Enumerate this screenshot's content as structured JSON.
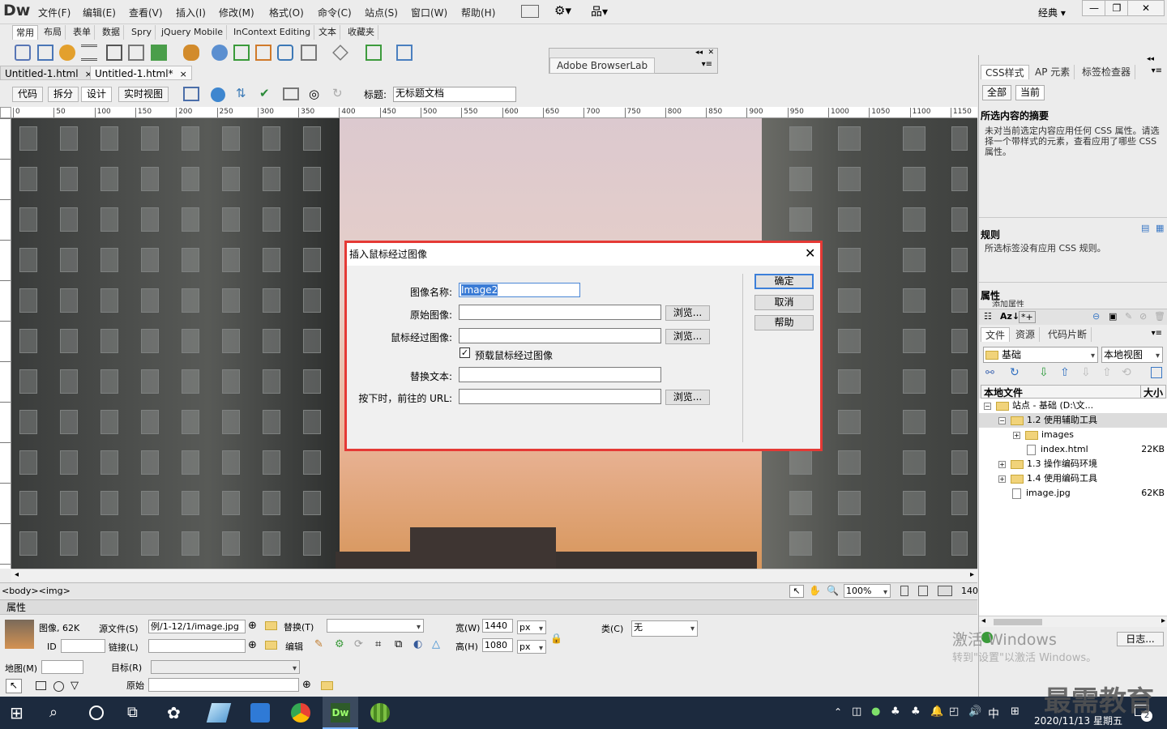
{
  "app": {
    "logo": "Dw",
    "menus": [
      "文件(F)",
      "编辑(E)",
      "查看(V)",
      "插入(I)",
      "修改(M)",
      "格式(O)",
      "命令(C)",
      "站点(S)",
      "窗口(W)",
      "帮助(H)"
    ],
    "workspace": "经典",
    "window_controls": [
      "—",
      "❐",
      "✕"
    ]
  },
  "insert_bar": {
    "tabs": [
      "常用",
      "布局",
      "表单",
      "数据",
      "Spry",
      "jQuery Mobile",
      "InContext Editing",
      "文本",
      "收藏夹"
    ]
  },
  "browserlab": {
    "title": "Adobe BrowserLab"
  },
  "documents": {
    "tabs": [
      {
        "label": "Untitled-1.html",
        "close": "×"
      },
      {
        "label": "Untitled-1.html*",
        "close": "×"
      }
    ]
  },
  "doc_toolbar": {
    "views": [
      "代码",
      "拆分",
      "设计",
      "实时视图"
    ],
    "title_label": "标题:",
    "title_value": "无标题文档"
  },
  "ruler": {
    "h_ticks": [
      "0",
      "50",
      "100",
      "150",
      "200",
      "250",
      "300",
      "350",
      "400",
      "450",
      "500",
      "550",
      "600",
      "650",
      "700",
      "750",
      "800",
      "850",
      "900",
      "950",
      "1000",
      "1050",
      "1100",
      "1150"
    ]
  },
  "status_bar": {
    "tag_selector": "<body><img>",
    "zoom": "100%",
    "width_text": "140"
  },
  "dialog": {
    "title": "插入鼠标经过图像",
    "fields": {
      "image_name_label": "图像名称:",
      "image_name_value": "Image2",
      "original_label": "原始图像:",
      "rollover_label": "鼠标经过图像:",
      "preload_label": "预载鼠标经过图像",
      "alt_label": "替换文本:",
      "url_label": "按下时，前往的 URL:"
    },
    "browse": "浏览...",
    "buttons": {
      "ok": "确定",
      "cancel": "取消",
      "help": "帮助"
    }
  },
  "properties": {
    "header": "属性",
    "image_label": "图像, 62K",
    "src_label": "源文件(S)",
    "src_value": "例/1-12/1/image.jpg",
    "alt_label": "替换(T)",
    "width_label": "宽(W)",
    "width_value": "1440",
    "height_label": "高(H)",
    "height_value": "1080",
    "unit": "px",
    "class_label": "类(C)",
    "class_value": "无",
    "id_label": "ID",
    "link_label": "链接(L)",
    "edit_label": "编辑",
    "map_label": "地图(M)",
    "target_label": "目标(R)",
    "original_label": "原始"
  },
  "right_panel": {
    "css_tabs": [
      "CSS样式",
      "AP 元素",
      "标签检查器"
    ],
    "mode_buttons": [
      "全部",
      "当前"
    ],
    "summary_heading": "所选内容的摘要",
    "summary_text": "未对当前选定内容应用任何 CSS 属性。请选择一个带样式的元素，查看应用了哪些 CSS 属性。",
    "rules_heading": "规则",
    "rules_text": "所选标签没有应用 CSS 规则。",
    "props_heading": "属性",
    "props_sub": "添加属性",
    "files_tabs": [
      "文件",
      "资源",
      "代码片断"
    ],
    "site_select": "基础",
    "view_select": "本地视图",
    "local_files_header": "本地文件",
    "size_header": "大小",
    "tree": [
      {
        "label": "站点 - 基础 (D:\\文...",
        "size": "",
        "level": 0,
        "folder": true,
        "toggle": "−"
      },
      {
        "label": "1.2 使用辅助工具",
        "size": "",
        "level": 1,
        "folder": true,
        "toggle": "−",
        "selected": true
      },
      {
        "label": "images",
        "size": "",
        "level": 2,
        "folder": true,
        "toggle": "+"
      },
      {
        "label": "index.html",
        "size": "22KB",
        "level": 2,
        "folder": false,
        "toggle": ""
      },
      {
        "label": "1.3 操作编码环境",
        "size": "",
        "level": 1,
        "folder": true,
        "toggle": "+"
      },
      {
        "label": "1.4 使用编码工具",
        "size": "",
        "level": 1,
        "folder": true,
        "toggle": "+"
      },
      {
        "label": "image.jpg",
        "size": "62KB",
        "level": 1,
        "folder": false,
        "toggle": ""
      }
    ],
    "log_button": "日志..."
  },
  "watermark": {
    "line1": "激活 Windows",
    "line2": "转到\"设置\"以激活 Windows。"
  },
  "taskbar": {
    "ime": "中",
    "date": "2020/11/13 星期五",
    "notification_count": "2",
    "brand": "最需教育"
  }
}
